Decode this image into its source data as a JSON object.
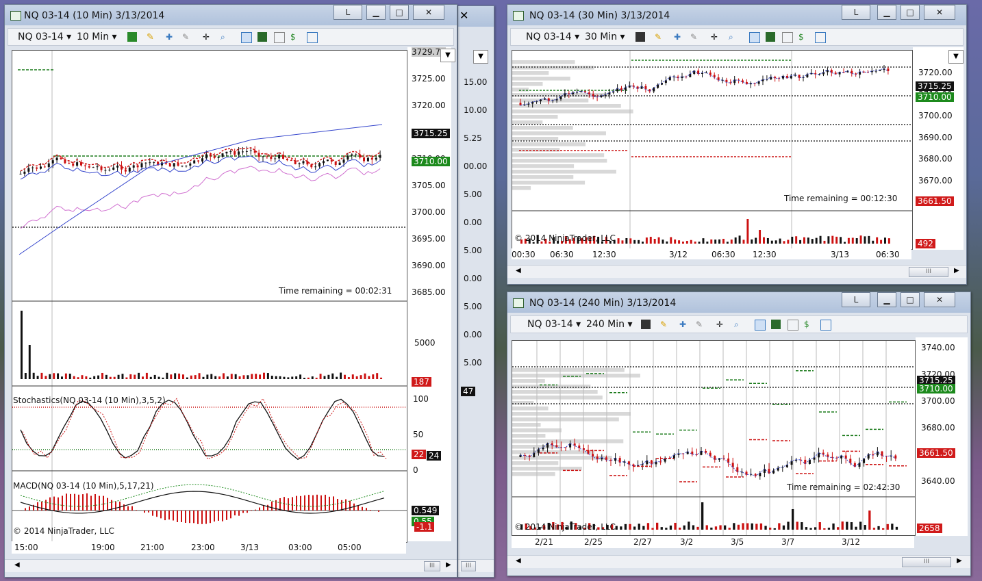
{
  "windows": {
    "w10": {
      "title": "NQ 03-14 (10 Min)  3/13/2014",
      "instrument": "NQ 03-14",
      "period": "10 Min",
      "btn_l": "L",
      "price_ticks": [
        "3729.75",
        "3725.00",
        "3720.00",
        "3715.00",
        "3710.00",
        "3705.00",
        "3700.00",
        "3695.00",
        "3690.00",
        "3685.00"
      ],
      "tag_last": "3715.25",
      "tag_level": "3710.00",
      "time_remaining": "Time remaining = 00:02:31",
      "volume_tick": "5000",
      "volume_tag": "187",
      "stoch_label": "Stochastics(NQ 03-14 (10 Min),3,5,2)",
      "stoch_ticks": [
        "100",
        "50",
        "0"
      ],
      "stoch_tag1": "22",
      "stoch_tag2": "24",
      "macd_label": "MACD(NQ 03-14 (10 Min),5,17,21)",
      "macd_tag1": "0.549",
      "macd_tag2": "0.55",
      "macd_tag3": "-1.1",
      "copyright": "© 2014 NinjaTrader, LLC",
      "time_axis": [
        "15:00",
        "19:00",
        "21:00",
        "23:00",
        "3/13",
        "03:00",
        "05:00"
      ],
      "scroll_thumb": "III"
    },
    "w30": {
      "title": "NQ 03-14 (30 Min)  3/13/2014",
      "instrument": "NQ 03-14",
      "period": "30 Min",
      "btn_l": "L",
      "price_ticks": [
        "3720.00",
        "3710.00",
        "3700.00",
        "3690.00",
        "3680.00",
        "3670.00"
      ],
      "tag_last": "3715.25",
      "tag_level": "3710.00",
      "tag_low": "3661.50",
      "time_remaining": "Time remaining = 00:12:30",
      "volume_tag": "492",
      "copyright": "© 2014 NinjaTrader, LLC",
      "time_axis": [
        "00:30",
        "06:30",
        "12:30",
        "3/12",
        "06:30",
        "12:30",
        "3/13",
        "06:30"
      ],
      "scroll_thumb": "III"
    },
    "w240": {
      "title": "NQ 03-14 (240 Min)  3/13/2014",
      "instrument": "NQ 03-14",
      "period": "240 Min",
      "btn_l": "L",
      "price_ticks": [
        "3740.00",
        "3720.00",
        "3700.00",
        "3680.00",
        "3660.00",
        "3640.00"
      ],
      "tag_last": "3715.25",
      "tag_level": "3710.00",
      "tag_low": "3661.50",
      "time_remaining": "Time remaining = 02:42:30",
      "volume_tag": "2658",
      "copyright": "© 2014 NinjaTrader, LLC",
      "time_axis": [
        "2/21",
        "2/25",
        "2/27",
        "3/2",
        "3/5",
        "3/7",
        "3/12"
      ],
      "scroll_thumb": "III"
    },
    "behind": {
      "ticks": [
        "15.00",
        "10.00",
        "5.25",
        "00.00",
        "5.00",
        "0.00",
        "5.00",
        "0.00",
        "5.00",
        "0.00",
        "5.00"
      ],
      "tag": "47"
    }
  },
  "colors": {
    "up_candle": "#111111",
    "down_candle": "#cc1111",
    "level_green": "#1a7a1a",
    "level_red": "#cc1111",
    "tag_black": "#111111",
    "tag_green": "#1c8a1c",
    "tag_red": "#d01a1a"
  },
  "icons": {
    "window": "chart-window-icon",
    "minimize": "minimize-icon",
    "maximize": "maximize-icon",
    "close": "close-icon"
  }
}
